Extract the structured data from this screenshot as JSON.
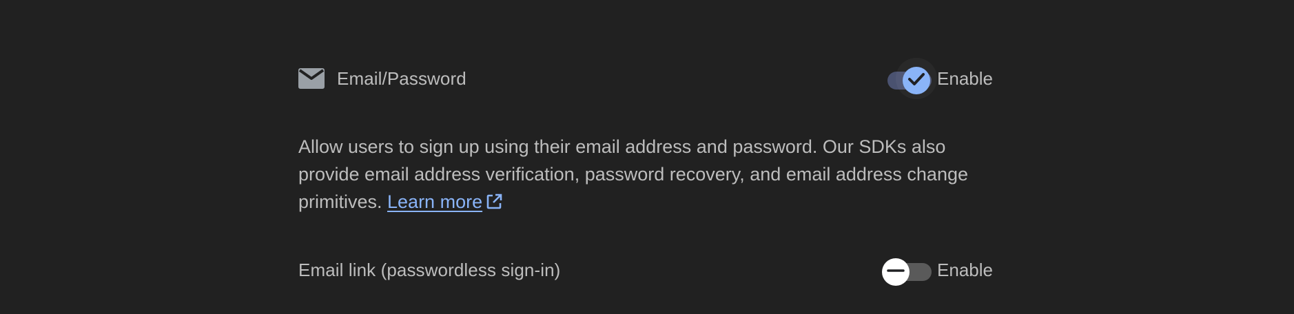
{
  "providers": [
    {
      "label": "Email/Password",
      "icon": "mail-icon",
      "enabled": true,
      "toggle_label": "Enable"
    },
    {
      "label": "Email link (passwordless sign-in)",
      "enabled": false,
      "toggle_label": "Enable"
    }
  ],
  "description": {
    "text": "Allow users to sign up using their email address and password. Our SDKs also provide email address verification, password recovery, and email address change primitives. ",
    "link_label": "Learn more",
    "link_icon": "external-link-icon"
  },
  "colors": {
    "background": "#212121",
    "text": "#bdbdbd",
    "accent": "#8ab4f8",
    "track_on": "#4a5270",
    "track_off": "#5a5a5a"
  }
}
